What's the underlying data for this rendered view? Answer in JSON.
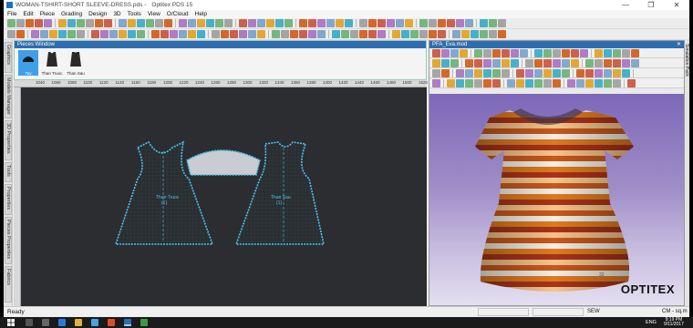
{
  "window": {
    "title": "WOMAN-TSHIRT-SHORT SLEEVE-DRESS.pds -",
    "app_name": "Optitex PDS 15",
    "controls": {
      "minimize": "—",
      "maximize": "❐",
      "close": "✕"
    }
  },
  "menu": [
    "File",
    "Edit",
    "Piece",
    "Grading",
    "Design",
    "3D",
    "Tools",
    "View",
    "O/Cloud",
    "Help"
  ],
  "left_tabs": [
    "Graphics",
    "Models Manager",
    "3D Properties",
    "Tools",
    "Properties",
    "Pieces Properties",
    "Fabrics"
  ],
  "right_tabs": [
    "Simulation Pack"
  ],
  "pieces_window": {
    "title": "Pieces Window",
    "pieces": [
      {
        "label": "Tay",
        "selected": true,
        "color": "#1a1a1a"
      },
      {
        "label": "Than Truoc",
        "selected": false,
        "color": "#2a2a2a"
      },
      {
        "label": "Than Sau",
        "selected": false,
        "color": "#2a2a2a"
      }
    ]
  },
  "ruler": {
    "ticks": [
      "1040",
      "1060",
      "1080",
      "1100",
      "1120",
      "1140",
      "1160",
      "1180",
      "1200",
      "1220",
      "1240",
      "1260",
      "1280",
      "1300",
      "1320",
      "1340",
      "1360",
      "1380",
      "1400",
      "1420",
      "1440",
      "1460",
      "1480",
      "1500",
      "1520"
    ]
  },
  "canvas": {
    "piece_labels": [
      {
        "id": "front",
        "name": "Than Truoc",
        "size": "(1)"
      },
      {
        "id": "back",
        "name": "Than Sau",
        "size": "(1)"
      }
    ]
  },
  "viewer": {
    "title": "PFA_Eva.mod",
    "close": "✕",
    "brand": "OPTITEX",
    "stripe_colors": [
      "#f4efe6",
      "#e07a1e",
      "#a8331a",
      "#f6c48a",
      "#c9581c"
    ],
    "fabric_number": "32"
  },
  "status": {
    "left": "Ready",
    "mode": "SEW",
    "units": "CM - sq.m"
  },
  "taskbar": {
    "language": "ENG",
    "time": "9:19 PM",
    "date": "9/11/2017"
  },
  "colors": {
    "accent": "#2d6db0",
    "pattern_outline": "#4ec3f2",
    "canvas_bg": "#2b2d30",
    "selected_piece": "#3fa0e8"
  }
}
